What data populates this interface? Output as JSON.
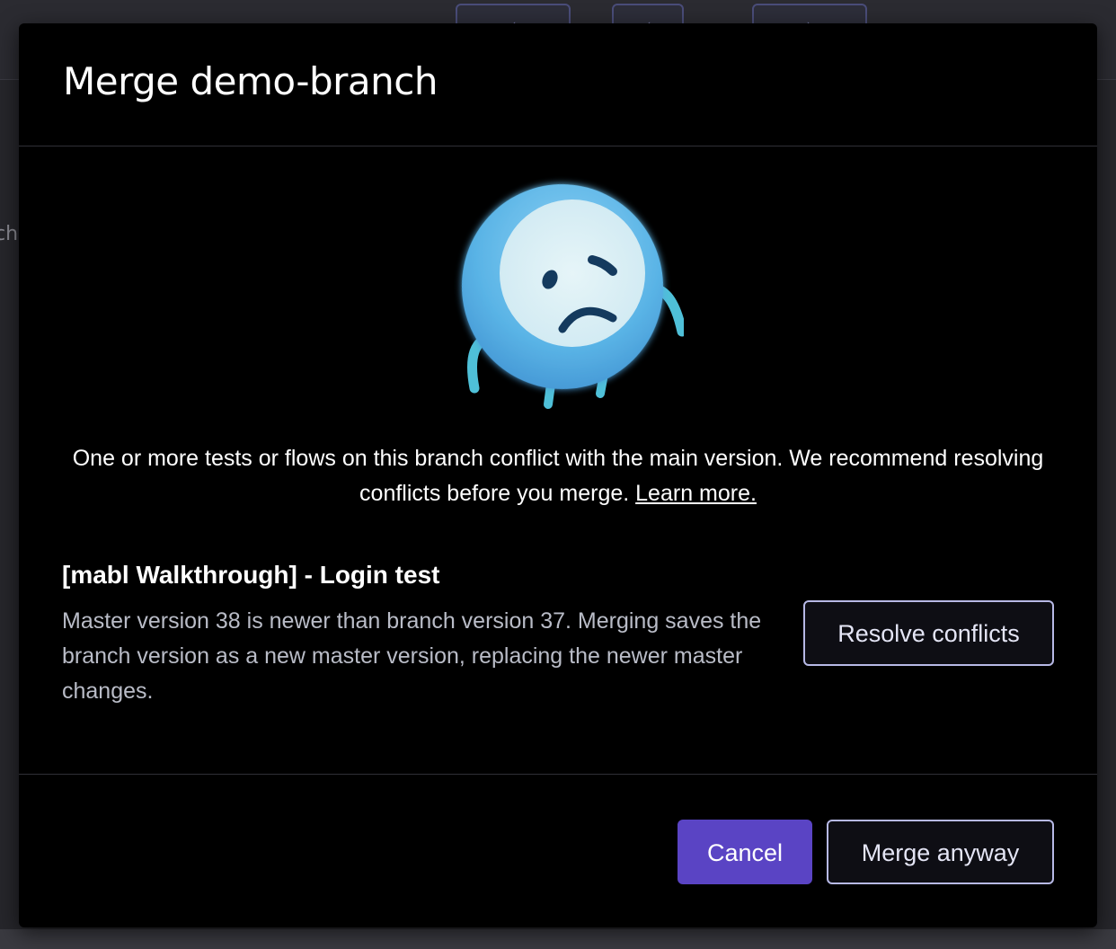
{
  "modal": {
    "title": "Merge demo-branch",
    "message": "One or more tests or flows on this branch conflict with the main version. We recommend resolving conflicts before you merge.",
    "learn_more": "Learn more.",
    "illustration": "sad-blob-mascot"
  },
  "conflict": {
    "title": "[mabl Walkthrough] - Login test",
    "description": "Master version 38 is newer than branch version 37. Merging saves the branch version as a new master version, replacing the newer master changes.",
    "resolve_label": "Resolve conflicts"
  },
  "footer": {
    "cancel_label": "Cancel",
    "merge_label": "Merge anyway"
  },
  "background": {
    "side_text": "ch"
  },
  "colors": {
    "primary": "#5a44c4",
    "outline": "#b7b9e6",
    "mascot_body": "#5ab4e6",
    "mascot_face": "#d8eef4"
  }
}
